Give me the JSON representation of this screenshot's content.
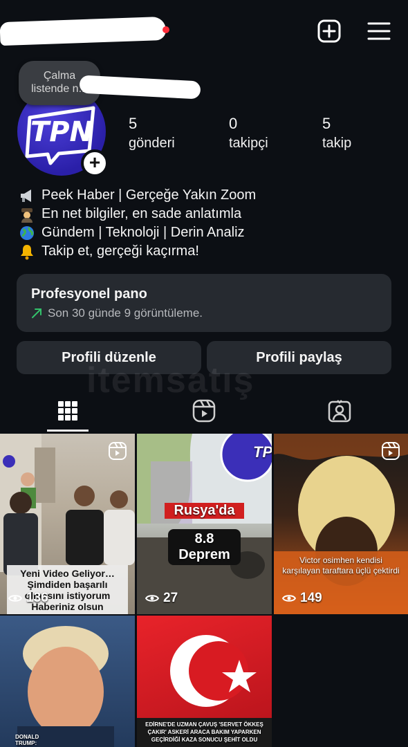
{
  "header": {
    "add_icon": "plus-square-icon",
    "menu_icon": "hamburger-menu-icon"
  },
  "note": {
    "text": "Çalma listende n..."
  },
  "avatar": {
    "logo_text": "TPN"
  },
  "stats": [
    {
      "value": "5",
      "label": "gönderi"
    },
    {
      "value": "0",
      "label": "takipçi"
    },
    {
      "value": "5",
      "label": "takip"
    }
  ],
  "bio": [
    {
      "icon": "megaphone-icon",
      "text": "Peek Haber | Gerçeğe Yakın Zoom"
    },
    {
      "icon": "detective-icon",
      "text": "En net bilgiler, en sade anlatımla"
    },
    {
      "icon": "globe-icon",
      "text": "Gündem | Teknoloji | Derin Analiz"
    },
    {
      "icon": "bell-icon",
      "text": "Takip et, gerçeği kaçırma!"
    }
  ],
  "dashboard": {
    "title": "Profesyonel pano",
    "subtitle": "Son 30 günde 9 görüntüleme.",
    "accent": "#33c26b"
  },
  "buttons": {
    "edit": "Profili düzenle",
    "share": "Profili paylaş"
  },
  "watermark": "itemsatış",
  "tabs": [
    "grid-icon",
    "reels-icon",
    "tagged-icon"
  ],
  "posts": [
    {
      "views": "136",
      "caption": "Yeni Video Geliyor…\nŞimdiden başarılı olmasını istiyorum\nHaberiniz olsun arkadaşlar"
    },
    {
      "views": "27",
      "headline_1": "Rusya'da",
      "headline_2": "8.8 Deprem",
      "logo": "TPN"
    },
    {
      "views": "149",
      "caption": "Victor osimhen kendisi karşılayan taraftara üçlü çektirdi"
    },
    {
      "caption": "DONALD TRUMP:"
    },
    {
      "caption": "EDİRNE'DE UZMAN ÇAVUŞ 'SERVET ÖKKEŞ ÇAKIR' ASKERİ ARACA BAKIM YAPARKEN GEÇİRDİĞİ KAZA SONUCU ŞEHİT OLDU"
    }
  ]
}
